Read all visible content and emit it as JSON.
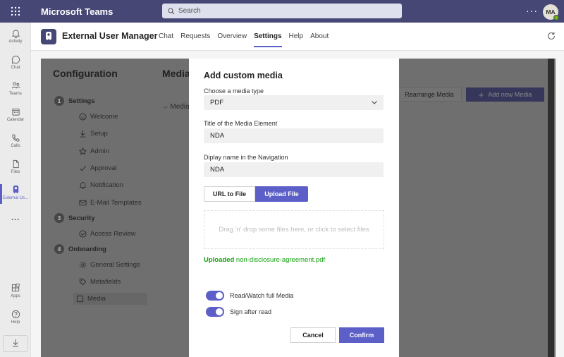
{
  "app": {
    "name": "Microsoft Teams"
  },
  "search": {
    "placeholder": "Search"
  },
  "user": {
    "initials": "MA"
  },
  "rail": [
    {
      "label": "Activity",
      "icon": "bell-icon"
    },
    {
      "label": "Chat",
      "icon": "chat-icon"
    },
    {
      "label": "Teams",
      "icon": "teams-icon"
    },
    {
      "label": "Calendar",
      "icon": "calendar-icon"
    },
    {
      "label": "Calls",
      "icon": "phone-icon"
    },
    {
      "label": "Files",
      "icon": "file-icon"
    },
    {
      "label": "External Us...",
      "icon": "external-user-icon"
    },
    {
      "label": "Apps",
      "icon": "apps-icon"
    },
    {
      "label": "Help",
      "icon": "help-icon"
    }
  ],
  "appbar": {
    "title": "External User Manager",
    "tabs": [
      "Chat",
      "Requests",
      "Overview",
      "Settings",
      "Help",
      "About"
    ],
    "active_tab": "Settings"
  },
  "config": {
    "title": "Configuration",
    "media_title": "Media",
    "steps": [
      {
        "num": "1",
        "label": "Settings",
        "items": [
          "Welcome",
          "Setup",
          "Admin",
          "Approval",
          "Notification",
          "E-Mail Templates"
        ]
      },
      {
        "num": "3",
        "label": "Security",
        "items": [
          "Access Review"
        ]
      },
      {
        "num": "4",
        "label": "Onboarding",
        "items": [
          "General Settings",
          "Metafields",
          "Media"
        ]
      }
    ],
    "media_row": "Media",
    "rearrange": "Rearrange Media",
    "add_new": "Add new Media"
  },
  "dialog": {
    "title": "Add custom media",
    "type_label": "Choose a media type",
    "type_value": "PDF",
    "title_label": "Title of the Media Element",
    "title_value": "NDA",
    "nav_label": "Diplay name in the Navigation",
    "nav_value": "NDA",
    "seg_url": "URL to File",
    "seg_upload": "Upload File",
    "drop_text": "Drag 'n' drop some files here, or click to select files",
    "uploaded_label": "Uploaded",
    "uploaded_file": "non-disclosure-agreement.pdf",
    "toggle1": "Read/Watch full Media",
    "toggle2": "Sign after read",
    "cancel": "Cancel",
    "confirm": "Confirm"
  },
  "colors": {
    "brand": "#464775",
    "accent": "#5b5fc7",
    "success": "#13a10e"
  }
}
